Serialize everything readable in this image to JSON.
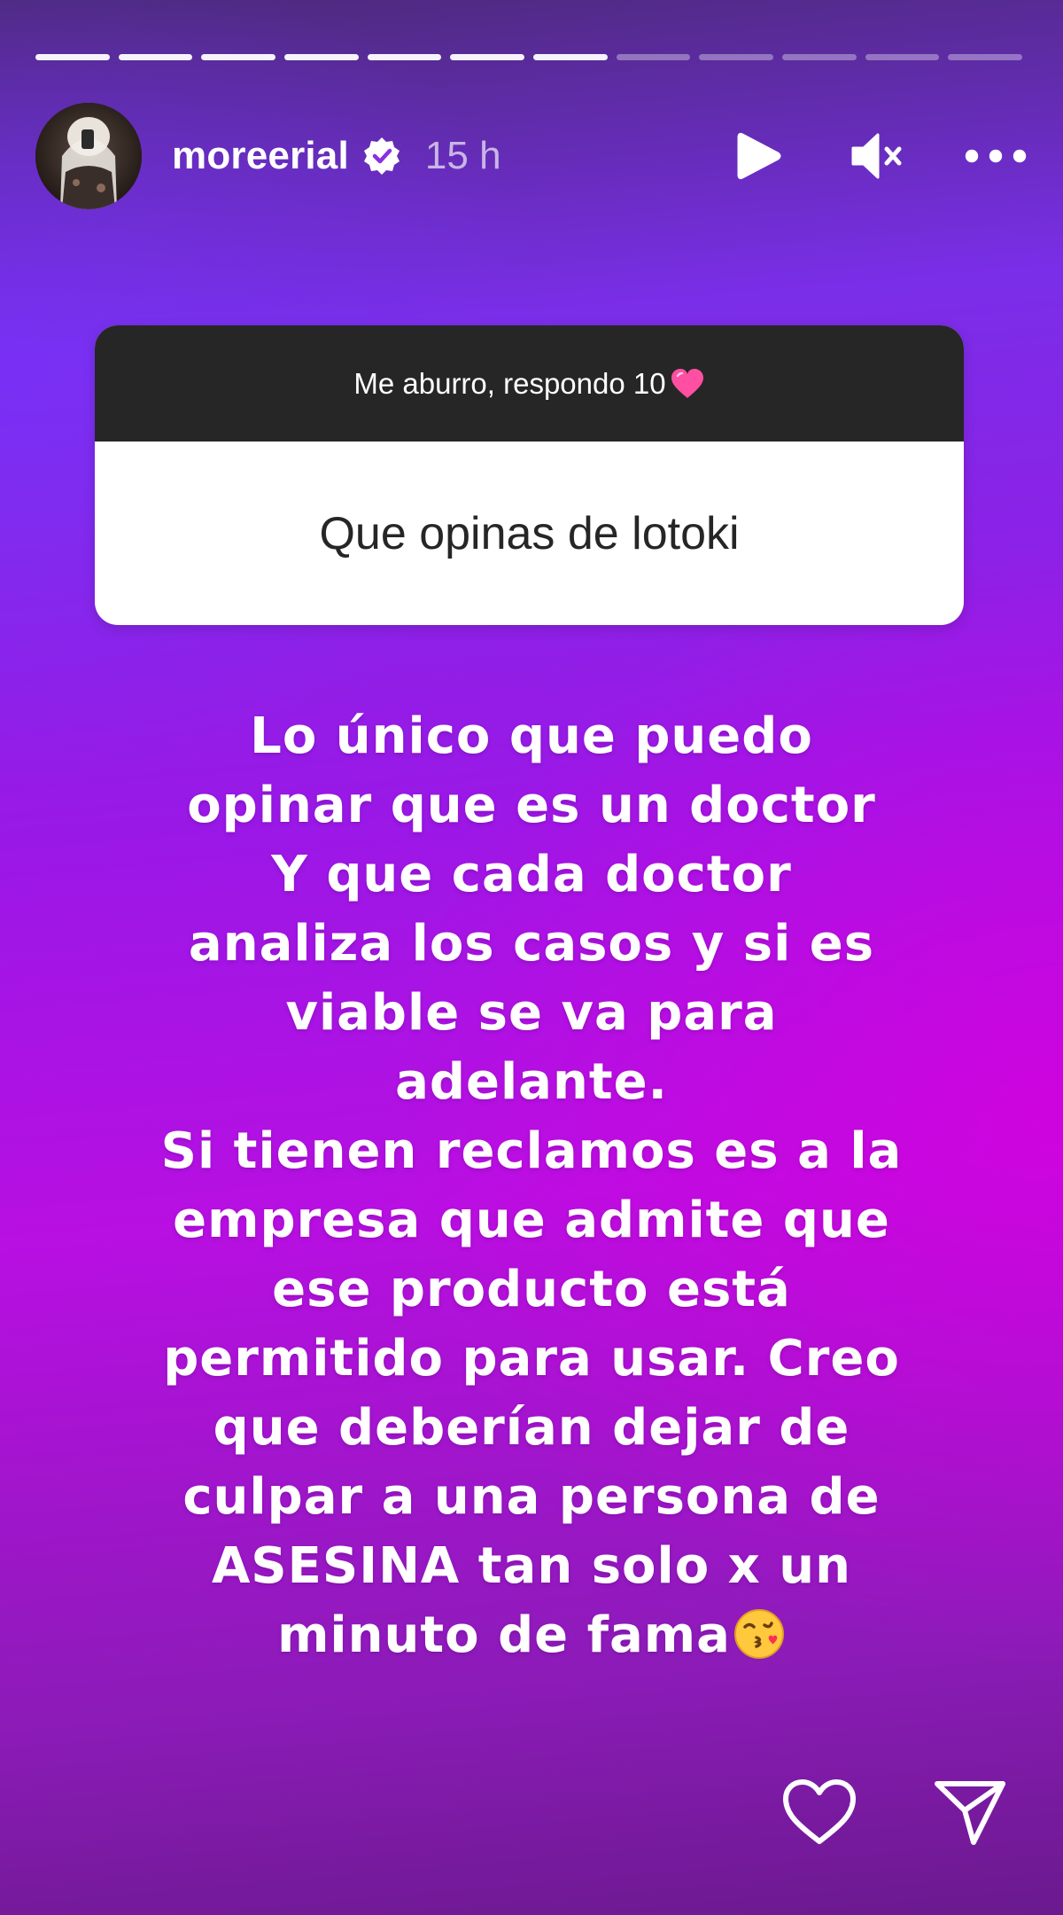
{
  "progress": {
    "segments": [
      1,
      1,
      1,
      1,
      1,
      1,
      1,
      0,
      0,
      0,
      0,
      0
    ]
  },
  "header": {
    "username": "moreerial",
    "time": "15 h",
    "avatar_icon": "profile-photo",
    "verified_icon": "verified-badge-icon",
    "play_icon": "play-icon",
    "mute_icon": "speaker-muted-icon",
    "more_icon": "more-options-icon"
  },
  "question": {
    "prompt": "Me aburro, respondo 10",
    "prompt_emoji": "pink-heart",
    "answer": "Que opinas de lotoki"
  },
  "reply": {
    "lines": [
      "Lo único que puedo",
      "opinar que es un doctor",
      "Y que cada doctor",
      "analiza los casos y si es",
      "viable se va para",
      "adelante.",
      "Si tienen reclamos es a la",
      "empresa que admite que",
      "ese producto está",
      "permitido para usar. Creo",
      "que deberían dejar de",
      "culpar a una persona de",
      "ASESINA tan solo x un",
      "minuto de fama"
    ],
    "end_emoji": "face-blowing-a-kiss"
  },
  "footer": {
    "like_icon": "heart-outline-icon",
    "share_icon": "send-icon"
  },
  "colors": {
    "header_bar": "#262626",
    "sticker_body": "#ffffff",
    "text": "#ffffff",
    "heart_emoji": "#ff4fa3"
  }
}
